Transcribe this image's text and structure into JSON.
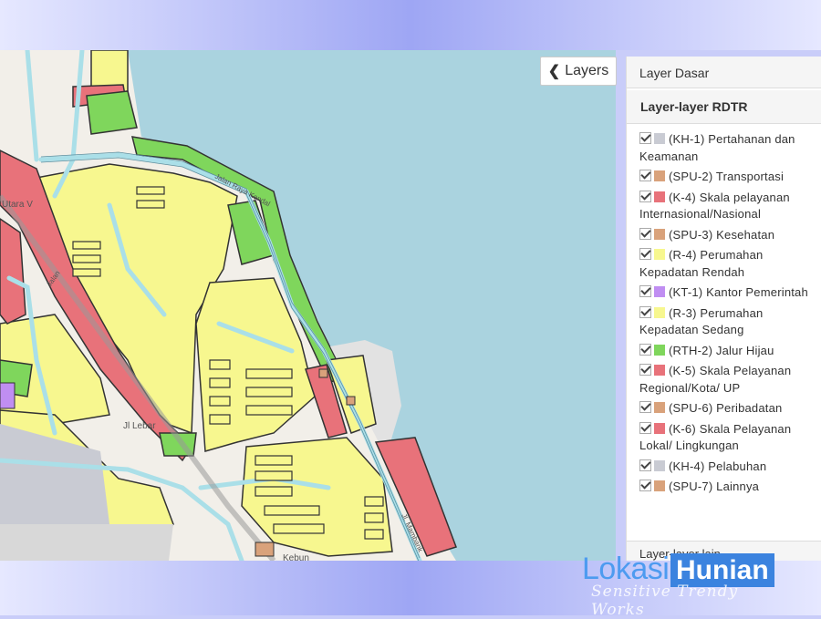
{
  "map": {
    "layers_button_label": "Layers",
    "street_labels": [
      "Utara V",
      "Jl Lebar",
      "Kebun",
      "Jalan Raya Kendal",
      "Jalan",
      "Jl. Mambank"
    ]
  },
  "panel": {
    "base_layer_title": "Layer Dasar",
    "rdtr_title": "Layer-layer RDTR",
    "footer_title": "Layer-layer lain",
    "layers": [
      {
        "label": "(KH-1) Pertahanan dan Keamanan",
        "color": "#c9cbd3",
        "checked": true
      },
      {
        "label": "(SPU-2) Transportasi",
        "color": "#d9a27b",
        "checked": true
      },
      {
        "label": "(K-4) Skala pelayanan Internasional/Nasional",
        "color": "#e8727a",
        "checked": true
      },
      {
        "label": "(SPU-3) Kesehatan",
        "color": "#d9a27b",
        "checked": true
      },
      {
        "label": "(R-4) Perumahan Kepadatan Rendah",
        "color": "#f7f78f",
        "checked": true
      },
      {
        "label": "(KT-1) Kantor Pemerintah",
        "color": "#c08ef2",
        "checked": true
      },
      {
        "label": "(R-3) Perumahan Kepadatan Sedang",
        "color": "#f7f78f",
        "checked": true
      },
      {
        "label": "(RTH-2) Jalur Hijau",
        "color": "#7fd65c",
        "checked": true
      },
      {
        "label": "(K-5) Skala Pelayanan Regional/Kota/ UP",
        "color": "#e8727a",
        "checked": true
      },
      {
        "label": "(SPU-6) Peribadatan",
        "color": "#d9a27b",
        "checked": true
      },
      {
        "label": "(K-6) Skala Pelayanan Lokal/ Lingkungan",
        "color": "#e8727a",
        "checked": true
      },
      {
        "label": "(KH-4) Pelabuhan",
        "color": "#c9cbd3",
        "checked": true
      },
      {
        "label": "(SPU-7) Lainnya",
        "color": "#d9a27b",
        "checked": true
      }
    ]
  },
  "watermark": {
    "word1": "Lokasi",
    "word2": "Hunian"
  },
  "colors": {
    "water": "#aad3df",
    "residential": "#f7f78f",
    "commercial": "#e8727a",
    "green": "#7fd65c",
    "road": "#aadfe8",
    "grey": "#c9cbd3"
  }
}
